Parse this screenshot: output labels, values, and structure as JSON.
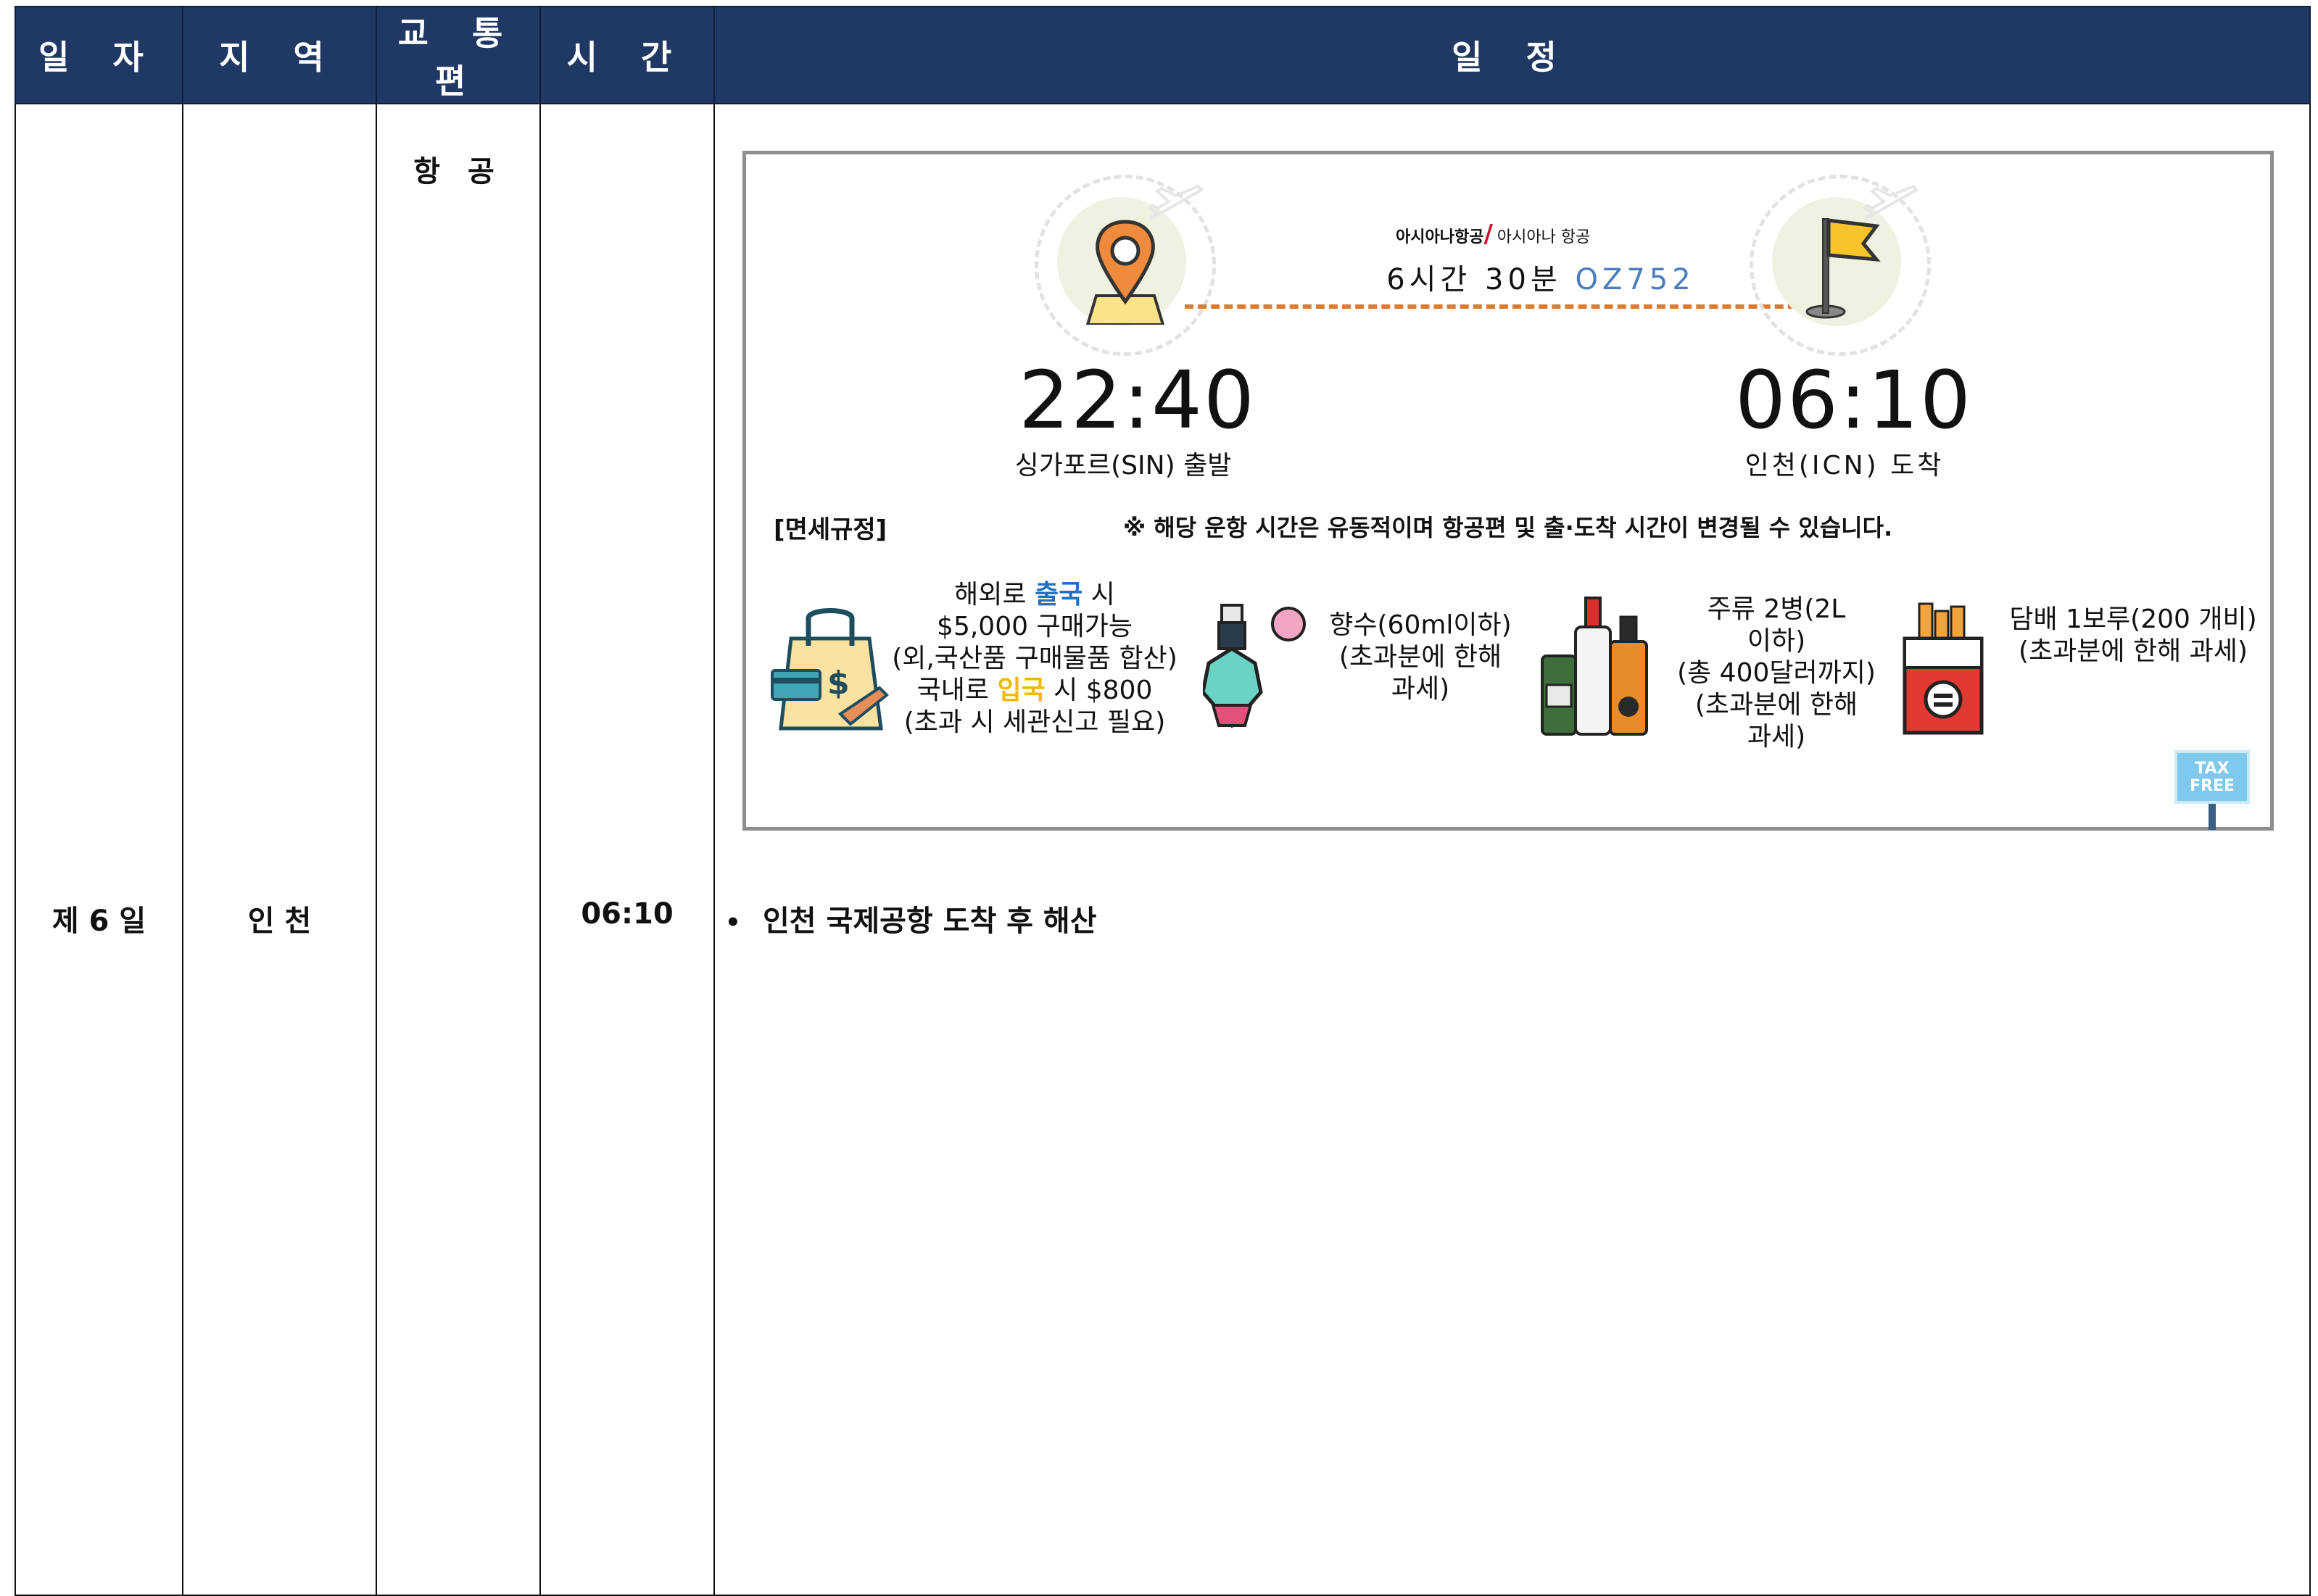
{
  "header": {
    "date_col": "일 자",
    "region_col": "지 역",
    "transport_col": "교 통 편",
    "time_col": "시 간",
    "schedule_col": "일 정"
  },
  "row": {
    "day": "제 6 일",
    "region": "인 천",
    "transport": "항 공",
    "time": "06:10",
    "bullet": "•",
    "schedule_item": "인천 국제공항 도착 후 해산"
  },
  "flight": {
    "airline_logo_text": "아시아나항공",
    "airline_name": "아시아나 항공",
    "duration": "6시간 30분",
    "flight_no": "OZ752",
    "depart_time": "22:40",
    "depart_label": "싱가포르(SIN) 출발",
    "arrive_time": "06:10",
    "arrive_label": "인천(ICN) 도착",
    "accent_color": "#e07b2d"
  },
  "duty_free": {
    "title": "[면세규정]",
    "notice": "※ 해당 운항 시간은 유동적이며 항공편 및 출·도착 시간이 변경될 수 있습니다.",
    "shopping": {
      "l1_a": "해외로 ",
      "l1_b": "출국",
      "l1_c": " 시",
      "l2": "$5,000 구매가능",
      "l3": "(외,국산품 구매물품 합산)",
      "l4_a": "국내로 ",
      "l4_b": "입국",
      "l4_c": " 시 $800",
      "l5": "(초과 시 세관신고 필요)"
    },
    "perfume": {
      "l1": "향수(60ml이하)",
      "l2": "(초과분에 한해",
      "l3": "과세)"
    },
    "liquor": {
      "l1": "주류 2병(2L",
      "l2": "이하)",
      "l3": "(총 400달러까지)",
      "l4": "(초과분에 한해",
      "l5": "과세)"
    },
    "tobacco": {
      "l1": "담배 1보루(200 개비)",
      "l2": "(초과분에 한해 과세)"
    },
    "tax_free_sign_l1": "TAX",
    "tax_free_sign_l2": "FREE"
  },
  "colors": {
    "header_bg": "#1f3864",
    "link_blue": "#1f6fc4",
    "gold": "#f3b800"
  }
}
